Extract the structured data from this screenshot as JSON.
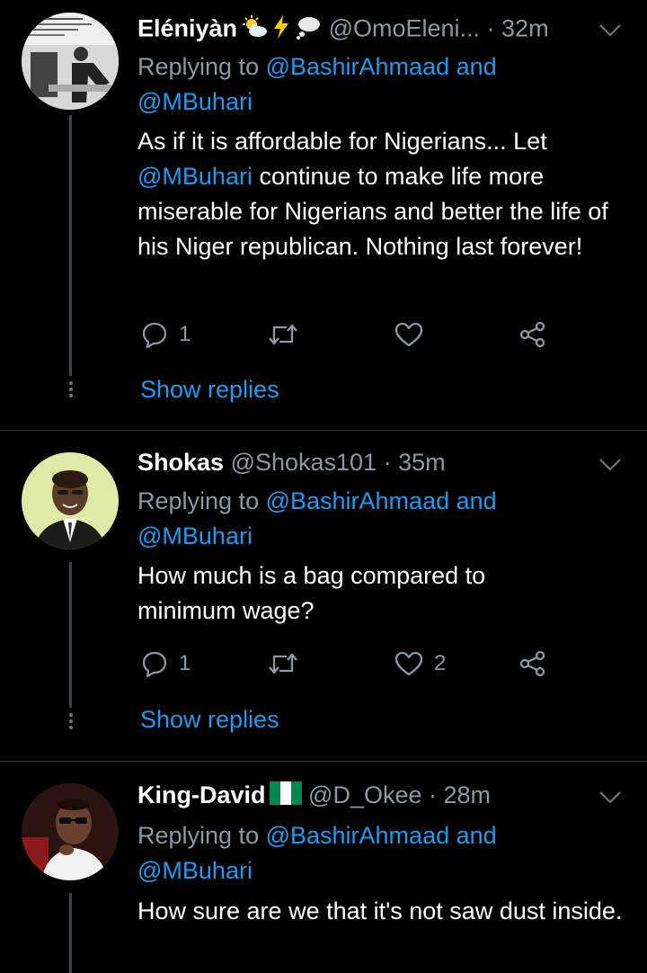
{
  "tweets": [
    {
      "name": "Eléniyàn",
      "emojis": [
        "sun-behind-cloud",
        "lightning",
        "thought-balloon"
      ],
      "handle": "@OmoEleni...",
      "time": "· 32m",
      "replying_prefix": "Replying to ",
      "replying_to_1": "@BashirAhmaad",
      "replying_and": " and",
      "replying_to_2": "@MBuhari",
      "body_1": "As if it is affordable for Nigerians... Let ",
      "body_mention": "@MBuhari",
      "body_2": " continue to make life more miserable for Nigerians and better the life of his Niger republican. Nothing last forever!",
      "reply_count": "1",
      "retweet_count": "",
      "like_count": "",
      "show_replies": "Show replies"
    },
    {
      "name": "Shokas",
      "handle": "@Shokas101",
      "time": "· 35m",
      "replying_prefix": "Replying to ",
      "replying_to_1": "@BashirAhmaad",
      "replying_and": " and",
      "replying_to_2": "@MBuhari",
      "body": "How much is a bag compared to minimum wage?",
      "reply_count": "1",
      "retweet_count": "",
      "like_count": "2",
      "show_replies": "Show replies"
    },
    {
      "name": "King-David",
      "flag": "nigeria-flag",
      "handle": "@D_Okee",
      "time": "· 28m",
      "replying_prefix": "Replying to ",
      "replying_to_1": "@BashirAhmaad",
      "replying_and": " and",
      "replying_to_2": "@MBuhari",
      "body": "How sure are we that it's not saw dust inside."
    }
  ],
  "colors": {
    "background": "#000000",
    "link": "#1d9bf0",
    "muted": "#8b98a5",
    "text": "#ffffff"
  }
}
